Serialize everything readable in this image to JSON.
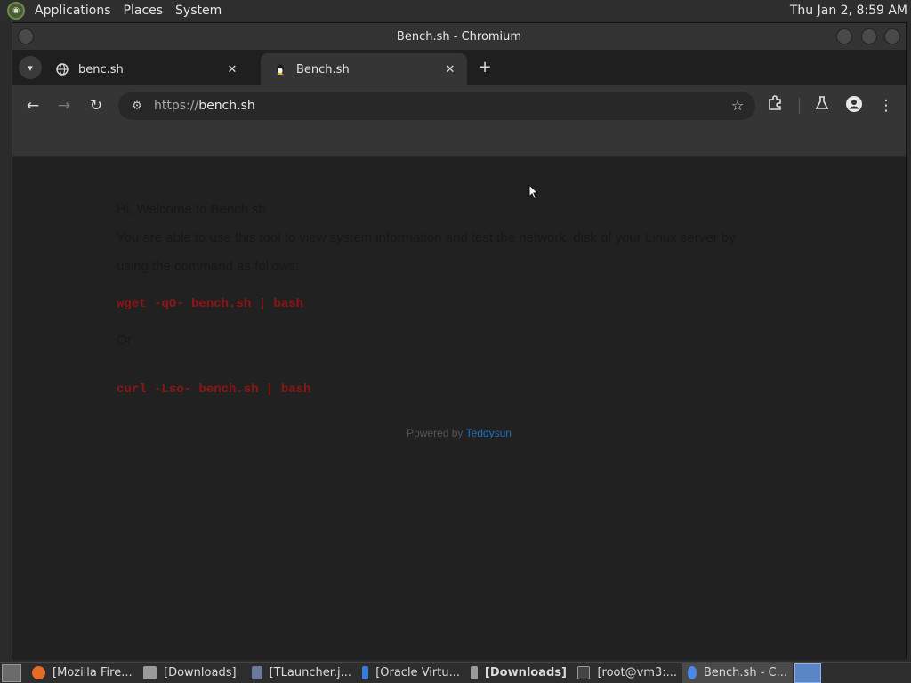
{
  "top_panel": {
    "menus": [
      "Applications",
      "Places",
      "System"
    ],
    "clock": "Thu Jan  2,  8:59 AM"
  },
  "window": {
    "title": "Bench.sh - Chromium"
  },
  "tabs": [
    {
      "title": "benc.sh",
      "favicon": "globe-icon",
      "close": "✕"
    },
    {
      "title": "Bench.sh",
      "favicon": "tux-icon",
      "close": "✕"
    }
  ],
  "toolbar": {
    "url_scheme": "https://",
    "url_host": "bench.sh"
  },
  "page": {
    "greeting": "Hi, Welcome to Bench.sh",
    "intro_line1": "You are able to use this tool to view system information and test the network, disk of your Linux server by",
    "intro_line2": "using the command as follows:",
    "command1": "wget -qO- bench.sh | bash",
    "or": "Or",
    "command2": "curl -Lso- bench.sh | bash",
    "powered_prefix": "Powered by ",
    "powered_link": "Teddysun"
  },
  "taskbar": {
    "items": [
      {
        "label": "[Mozilla Fire...",
        "icon": "firefox-icon",
        "color": "#e66b2b"
      },
      {
        "label": "[Downloads]",
        "icon": "folder-icon",
        "color": "#9a9a9a"
      },
      {
        "label": "[TLauncher.j...",
        "icon": "java-icon",
        "color": "#6c7a9a"
      },
      {
        "label": "[Oracle Virtu...",
        "icon": "virtualbox-icon",
        "color": "#3a7bd5"
      },
      {
        "label": "[Downloads]",
        "icon": "folder-icon",
        "color": "#9a9a9a"
      },
      {
        "label": "[root@vm3:...",
        "icon": "terminal-icon",
        "color": "#444444"
      },
      {
        "label": "Bench.sh - C...",
        "icon": "chromium-icon",
        "color": "#4a8ae6"
      }
    ]
  }
}
